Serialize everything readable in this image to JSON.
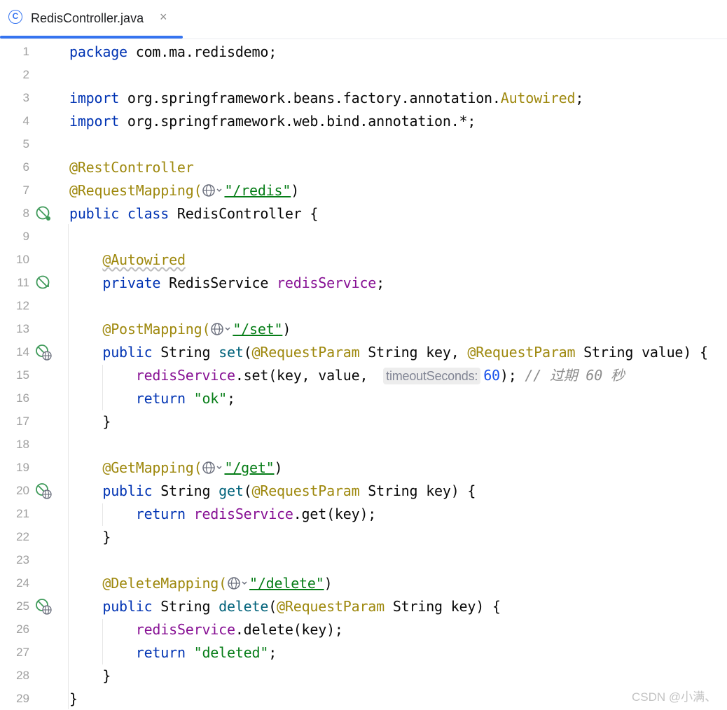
{
  "tab": {
    "title": "RedisController.java",
    "close": "×",
    "icon": "C"
  },
  "lines": [
    {
      "n": "1"
    },
    {
      "n": "2"
    },
    {
      "n": "3"
    },
    {
      "n": "4"
    },
    {
      "n": "5"
    },
    {
      "n": "6"
    },
    {
      "n": "7"
    },
    {
      "n": "8"
    },
    {
      "n": "9"
    },
    {
      "n": "10"
    },
    {
      "n": "11"
    },
    {
      "n": "12"
    },
    {
      "n": "13"
    },
    {
      "n": "14"
    },
    {
      "n": "15"
    },
    {
      "n": "16"
    },
    {
      "n": "17"
    },
    {
      "n": "18"
    },
    {
      "n": "19"
    },
    {
      "n": "20"
    },
    {
      "n": "21"
    },
    {
      "n": "22"
    },
    {
      "n": "23"
    },
    {
      "n": "24"
    },
    {
      "n": "25"
    },
    {
      "n": "26"
    },
    {
      "n": "27"
    },
    {
      "n": "28"
    },
    {
      "n": "29"
    }
  ],
  "code": {
    "l1": [
      "package",
      " com.ma.redisdemo;"
    ],
    "l3": [
      "import",
      " org.springframework.beans.factory.annotation.",
      "Autowired",
      ";"
    ],
    "l4": [
      "import",
      " org.springframework.web.bind.annotation.*;"
    ],
    "l6": [
      "@RestController"
    ],
    "l7": [
      "@RequestMapping(",
      "\"/redis\"",
      ")"
    ],
    "l8": [
      "public class",
      " RedisController {"
    ],
    "l10": [
      "@Autowired"
    ],
    "l11": [
      "private",
      " RedisService ",
      "redisService",
      ";"
    ],
    "l13": [
      "@PostMapping(",
      "\"/set\"",
      ")"
    ],
    "l14": [
      "public",
      " String ",
      "set",
      "(",
      "@RequestParam",
      " String key, ",
      "@RequestParam",
      " String value) {"
    ],
    "l15": [
      "redisService",
      ".set(key, value, ",
      "timeoutSeconds:",
      "60",
      ");",
      " // 过期 60 秒"
    ],
    "l16": [
      "return",
      " ",
      "\"ok\"",
      ";"
    ],
    "l17": [
      "}"
    ],
    "l19": [
      "@GetMapping(",
      "\"/get\"",
      ")"
    ],
    "l20": [
      "public",
      " String ",
      "get",
      "(",
      "@RequestParam",
      " String key) {"
    ],
    "l21": [
      "return",
      " ",
      "redisService",
      ".get(key);"
    ],
    "l22": [
      "}"
    ],
    "l24": [
      "@DeleteMapping(",
      "\"/delete\"",
      ")"
    ],
    "l25": [
      "public",
      " String ",
      "delete",
      "(",
      "@RequestParam",
      " String key) {"
    ],
    "l26": [
      "redisService",
      ".delete(key);"
    ],
    "l27": [
      "return",
      " ",
      "\"deleted\"",
      ";"
    ],
    "l28": [
      "}"
    ],
    "l29": [
      "}"
    ]
  },
  "gutter_icons": {
    "l8": "spring-bean-icon",
    "l11": "spring-autowired-icon",
    "l14": "endpoint-globe-icon",
    "l20": "endpoint-globe-icon",
    "l25": "endpoint-globe-icon"
  },
  "colors": {
    "keyword": "#0033b3",
    "annotation": "#9e880d",
    "string": "#067d17",
    "field": "#871094",
    "method": "#00627a",
    "number": "#1750eb",
    "comment": "#8c8c8c",
    "tab_accent": "#3574f0",
    "gutter_icon": "#3f9a5a"
  },
  "watermark": "CSDN @小满、"
}
